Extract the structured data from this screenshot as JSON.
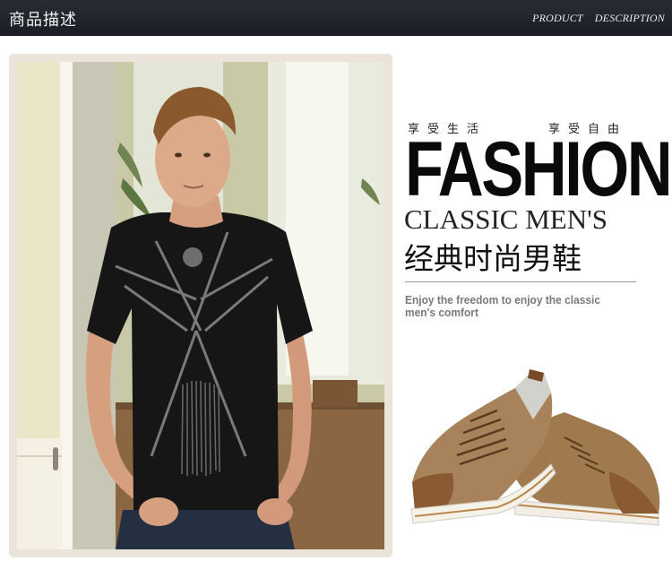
{
  "header": {
    "title": "商品描述",
    "subtitle_1": "PRODUCT",
    "subtitle_2": "DESCRIPTION"
  },
  "hero": {
    "tagline_left": "享受生活",
    "tagline_right": "享受自由",
    "headline": "FASHION",
    "subhead_en": "CLASSIC MEN'S",
    "subhead_cn": "经典时尚男鞋",
    "description": "Enjoy the freedom to enjoy the classic men's comfort"
  },
  "colors": {
    "header_bg": "#22242b",
    "shoe_tan": "#a07a4e",
    "shoe_suede": "#8a5a32",
    "tee": "#161616"
  }
}
